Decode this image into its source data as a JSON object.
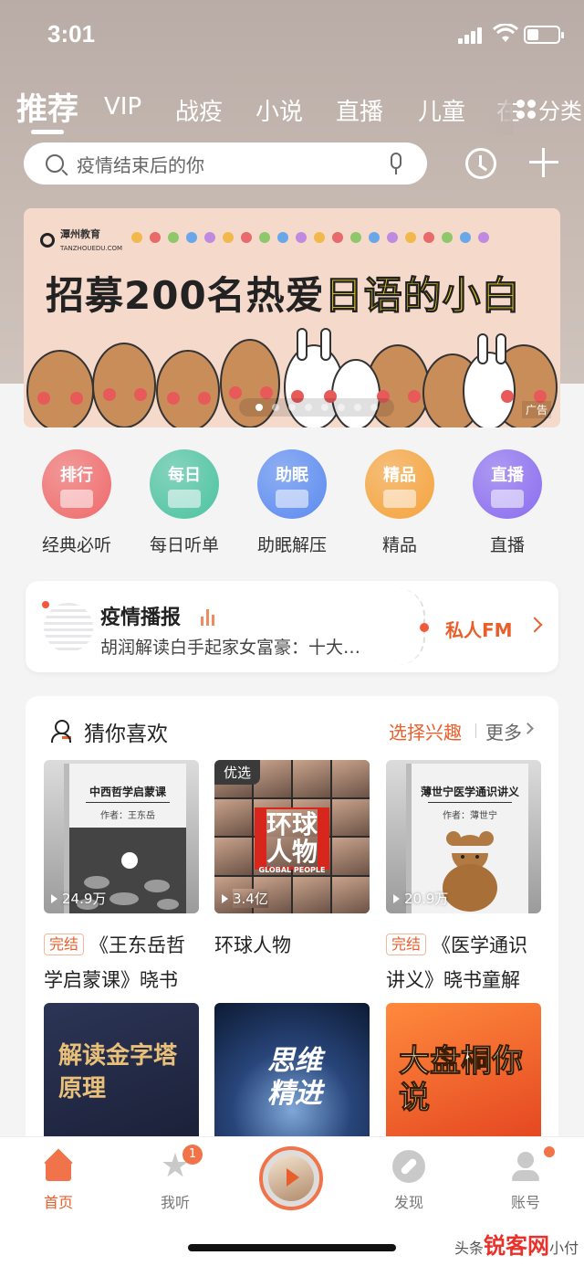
{
  "status_bar": {
    "time": "3:01"
  },
  "tabs": [
    "推荐",
    "VIP",
    "战疫",
    "小说",
    "直播",
    "儿童",
    "在"
  ],
  "category_button": "分类",
  "search": {
    "placeholder": "疫情结束后的你"
  },
  "banner": {
    "logo": "潭州教育",
    "logo_sub": "TANZHOUEDU.COM",
    "headline_part1": "招募200名热爱",
    "headline_part2": "日语的小白",
    "ad_label": "广告",
    "dot_colors": [
      "#f2b84b",
      "#e86a6a",
      "#8fc86b",
      "#6aa7e8",
      "#c08ae0",
      "#f2b84b",
      "#e86a6a",
      "#8fc86b",
      "#6aa7e8",
      "#c08ae0",
      "#f2b84b",
      "#e86a6a",
      "#8fc86b",
      "#6aa7e8",
      "#c08ae0",
      "#f2b84b",
      "#e86a6a",
      "#8fc86b",
      "#6aa7e8",
      "#c08ae0"
    ]
  },
  "categories": [
    {
      "icon_text": "排行",
      "label": "经典必听",
      "color": "#f06a6a"
    },
    {
      "icon_text": "每日",
      "label": "每日听单",
      "color": "#4dc3a0"
    },
    {
      "icon_text": "助眠",
      "label": "助眠解压",
      "color": "#5b8bf0"
    },
    {
      "icon_text": "精品",
      "label": "精品",
      "color": "#f5a33c"
    },
    {
      "icon_text": "直播",
      "label": "直播",
      "color": "#8a6cf0"
    }
  ],
  "news_card": {
    "title": "疫情播报",
    "subtitle": "胡润解读白手起家女富豪：十大…",
    "fm_label": "私人FM"
  },
  "recommend": {
    "title": "猜你喜欢",
    "pick_interest": "选择兴趣",
    "more": "更多",
    "items": [
      {
        "cover_title": "中西哲学启蒙课",
        "cover_author": "作者：王东岳",
        "plays": "24.9万",
        "badge": "完结",
        "title": "《王东岳哲学启蒙课》晓书"
      },
      {
        "cover_tag": "优选",
        "cover_title": "环球人物",
        "cover_sub": "GLOBAL PEOPLE",
        "plays": "3.4亿",
        "badge": "",
        "title": "环球人物"
      },
      {
        "cover_title": "薄世宁医学通识讲义",
        "cover_author": "作者：薄世宁",
        "plays": "20.9万",
        "badge": "完结",
        "title": "《医学通识讲义》晓书童解"
      },
      {
        "cover_title": "解读金字塔原理"
      },
      {
        "cover_title": "思维精进"
      },
      {
        "cover_title": "大盘桐你说"
      }
    ]
  },
  "bottom_nav": {
    "home": "首页",
    "listen": "我听",
    "listen_badge": "1",
    "discover": "发现",
    "account": "账号"
  },
  "watermark": {
    "brand": "锐客网",
    "prefix": "头条",
    "suffix": "小付"
  },
  "colors": {
    "accent": "#e95f2c",
    "top_bg": "#bfb2ac"
  }
}
